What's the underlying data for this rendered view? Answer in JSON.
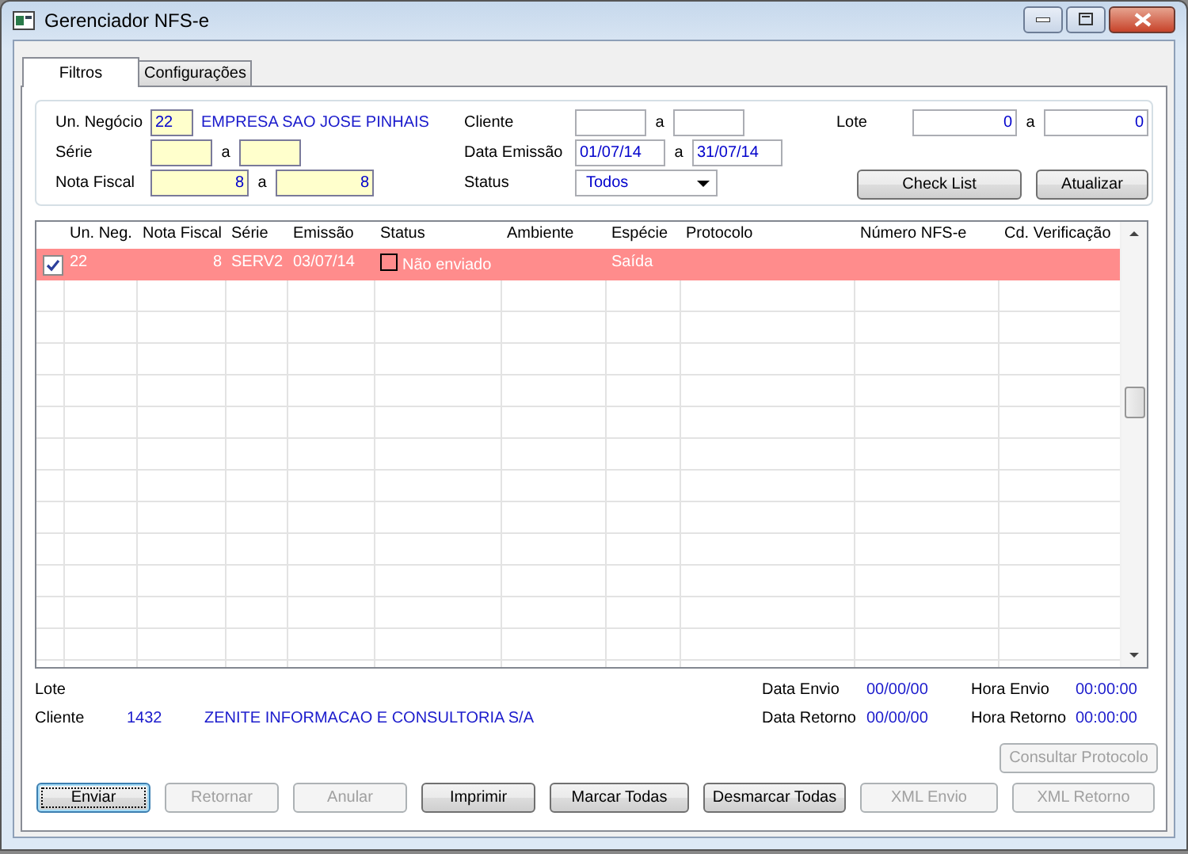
{
  "window": {
    "title": "Gerenciador NFS-e"
  },
  "tabs": [
    {
      "label": "Filtros",
      "selected": true
    },
    {
      "label": "Configurações",
      "selected": false
    }
  ],
  "filters": {
    "un_negocio": {
      "label": "Un. Negócio",
      "value": "22",
      "description": "EMPRESA SAO JOSE PINHAIS"
    },
    "serie": {
      "label": "Série",
      "separator": "a"
    },
    "nota_fiscal": {
      "label": "Nota Fiscal",
      "from": "8",
      "separator": "a",
      "to": "8"
    },
    "cliente": {
      "label": "Cliente",
      "separator": "a"
    },
    "data_emissao": {
      "label": "Data Emissão",
      "from": "01/07/14",
      "separator": "a",
      "to": "31/07/14"
    },
    "status": {
      "label": "Status",
      "value": "Todos"
    },
    "lote": {
      "label": "Lote",
      "from": "0",
      "separator": "a",
      "to": "0"
    }
  },
  "filter_buttons": [
    {
      "label": "Check List"
    },
    {
      "label": "Atualizar"
    }
  ],
  "table": {
    "columns": [
      "Un. Neg.",
      "Nota Fiscal",
      "Série",
      "Emissão",
      "Status",
      "Ambiente",
      "Espécie",
      "Protocolo",
      "Número NFS-e",
      "Cd. Verificação"
    ],
    "rows": [
      {
        "checked": true,
        "highlighted": true,
        "cells": [
          "22",
          "8",
          "SERV2",
          "03/07/14",
          "Não enviado",
          null,
          "Saída",
          null,
          null,
          null
        ]
      }
    ]
  },
  "info": {
    "lote": {
      "label": "Lote"
    },
    "cliente": {
      "label": "Cliente",
      "code": "1432",
      "name": "ZENITE INFORMACAO E CONSULTORIA S/A"
    },
    "data_envio": {
      "label": "Data Envio",
      "value": "00/00/00"
    },
    "hora_envio": {
      "label": "Hora Envio",
      "value": "00:00:00"
    },
    "data_retorno": {
      "label": "Data Retorno",
      "value": "00/00/00"
    },
    "hora_retorno": {
      "label": "Hora Retorno",
      "value": "00:00:00"
    }
  },
  "consult_button": {
    "label": "Consultar Protocolo",
    "disabled": true
  },
  "action_buttons": [
    {
      "label": "Enviar",
      "disabled": false,
      "focused": true
    },
    {
      "label": "Retornar",
      "disabled": true,
      "focused": false
    },
    {
      "label": "Anular",
      "disabled": true,
      "focused": false
    },
    {
      "label": "Imprimir",
      "disabled": false,
      "focused": false
    },
    {
      "label": "Marcar Todas",
      "disabled": false,
      "focused": false
    },
    {
      "label": "Desmarcar Todas",
      "disabled": false,
      "focused": false
    },
    {
      "label": "XML Envio",
      "disabled": true,
      "focused": false
    },
    {
      "label": "XML Retorno",
      "disabled": true,
      "focused": false
    }
  ]
}
